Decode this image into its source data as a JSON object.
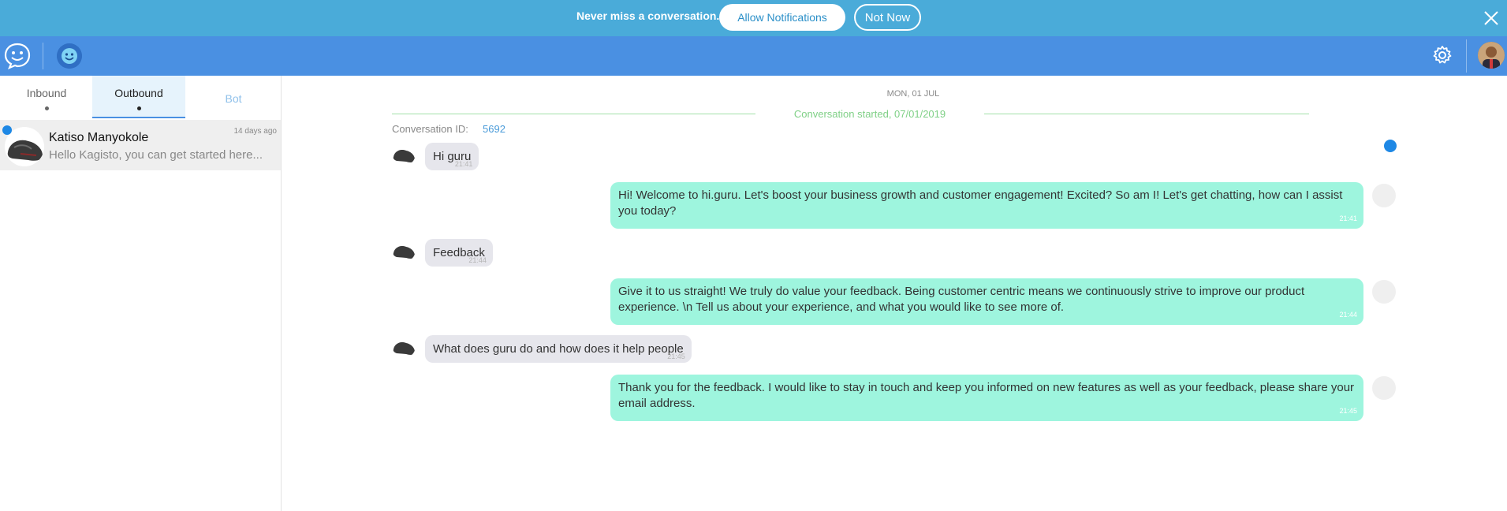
{
  "banner": {
    "text": "Never miss a conversation.",
    "allow_label": "Allow Notifications",
    "notnow_label": "Not Now"
  },
  "sidebar": {
    "tabs": [
      {
        "label": "Inbound"
      },
      {
        "label": "Outbound"
      },
      {
        "label": "Bot"
      }
    ],
    "conversations": [
      {
        "name": "Katiso Manyokole",
        "time": "14 days ago",
        "preview": "Hello Kagisto, you can get started here..."
      }
    ]
  },
  "chat": {
    "day": "MON, 01 JUL",
    "started": "Conversation started, 07/01/2019",
    "conversation_id_label": "Conversation ID:",
    "conversation_id": "5692",
    "messages": [
      {
        "direction": "in",
        "text": "Hi guru",
        "time": "21:41"
      },
      {
        "direction": "out",
        "text": "Hi! Welcome to hi.guru. Let's boost your business growth and customer engagement! Excited? So am I! Let's get chatting, how can I assist you today?",
        "time": "21:41"
      },
      {
        "direction": "in",
        "text": "Feedback",
        "time": "21:44"
      },
      {
        "direction": "out",
        "text": "Give it to us straight! We truly do value your feedback. Being customer centric means we continuously strive to improve our product experience. \\n Tell us about your experience, and what you would like to see more of.",
        "time": "21:44"
      },
      {
        "direction": "in",
        "text": "What does guru do and how does it help people",
        "time": "21:45"
      },
      {
        "direction": "out",
        "text": "Thank you for the feedback. I would like to stay in touch and keep you informed on new features as well as your feedback, please share your email address.",
        "time": "21:45"
      }
    ]
  },
  "colors": {
    "banner": "#4aabd9",
    "appbar": "#4a90e2",
    "outgoing_bubble": "#9ef5de",
    "incoming_bubble": "#e6e6ec"
  },
  "icons": [
    "close-icon",
    "guru-logo-icon",
    "settings-gear-icon",
    "messenger-icon",
    "agent-icon"
  ]
}
